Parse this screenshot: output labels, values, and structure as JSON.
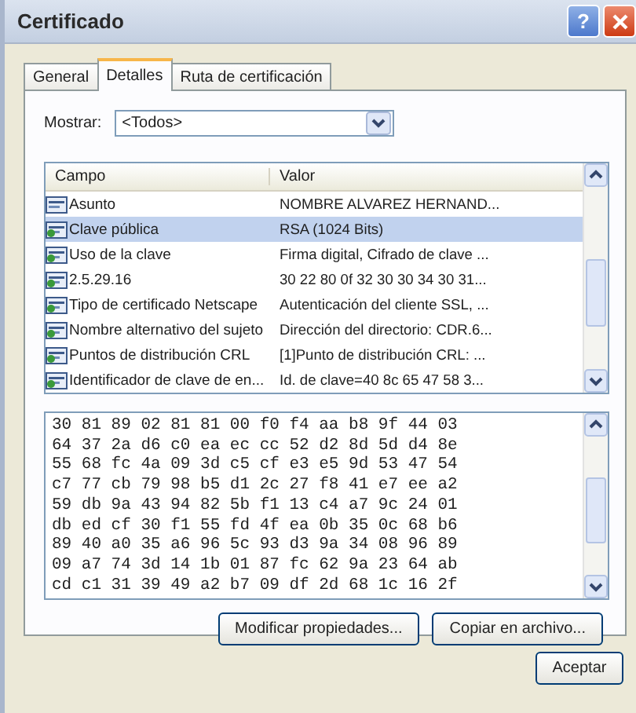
{
  "window": {
    "title": "Certificado",
    "help": "?"
  },
  "tabs": [
    {
      "label": "General",
      "selected": false
    },
    {
      "label": "Detalles",
      "selected": true
    },
    {
      "label": "Ruta de certificación",
      "selected": false
    }
  ],
  "show": {
    "label": "Mostrar:",
    "value": "<Todos>"
  },
  "fields": {
    "columns": [
      "Campo",
      "Valor"
    ],
    "rows": [
      {
        "field": "Asunto",
        "value": "NOMBRE ALVAREZ HERNAND...",
        "selected": false
      },
      {
        "field": "Clave pública",
        "value": "RSA (1024 Bits)",
        "selected": true
      },
      {
        "field": "Uso de la clave",
        "value": "Firma digital, Cifrado de clave ...",
        "selected": false
      },
      {
        "field": "2.5.29.16",
        "value": "30 22 80 0f 32 30 30 34 30 31...",
        "selected": false
      },
      {
        "field": "Tipo de certificado Netscape",
        "value": "Autenticación del cliente SSL, ...",
        "selected": false
      },
      {
        "field": "Nombre alternativo del sujeto",
        "value": "Dirección del directorio: CDR.6...",
        "selected": false
      },
      {
        "field": "Puntos de distribución CRL",
        "value": "[1]Punto de distribución CRL: ...",
        "selected": false
      },
      {
        "field": "Identificador de clave de en...",
        "value": "Id. de clave=40 8c 65 47 58 3...",
        "selected": false
      }
    ]
  },
  "detail_lines": [
    "30 81 89 02 81 81 00 f0 f4 aa b8 9f 44 03",
    "64 37 2a d6 c0 ea ec cc 52 d2 8d 5d d4 8e",
    "55 68 fc 4a 09 3d c5 cf e3 e5 9d 53 47 54",
    "c7 77 cb 79 98 b5 d1 2c 27 f8 41 e7 ee a2",
    "59 db 9a 43 94 82 5b f1 13 c4 a7 9c 24 01",
    "db ed cf 30 f1 55 fd 4f ea 0b 35 0c 68 b6",
    "89 40 a0 35 a6 96 5c 93 d3 9a 34 08 96 89",
    "09 a7 74 3d 14 1b 01 87 fc 62 9a 23 64 ab",
    "cd c1 31 39 49 a2 b7 09 df 2d 68 1c 16 2f"
  ],
  "panel_buttons": [
    "Modificar propiedades...",
    "Copiar en archivo..."
  ],
  "ok_button": "Aceptar"
}
